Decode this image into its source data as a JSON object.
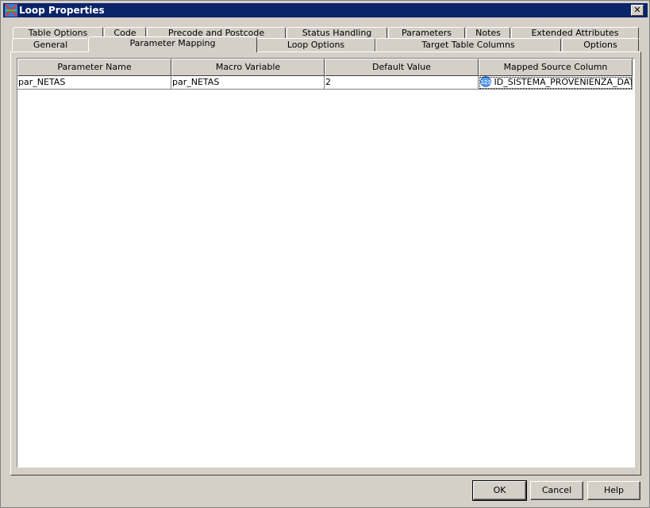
{
  "window": {
    "title": "Loop Properties",
    "close_label": "✕"
  },
  "tabs_row1": [
    "Table Options",
    "Code",
    "Precode and Postcode",
    "Status Handling",
    "Parameters",
    "Notes",
    "Extended Attributes"
  ],
  "tabs_row2": [
    "General",
    "Parameter Mapping",
    "Loop Options",
    "Target Table Columns",
    "Options"
  ],
  "active_tab": "Parameter Mapping",
  "table": {
    "columns": [
      "Parameter Name",
      "Macro Variable",
      "Default Value",
      "Mapped Source Column"
    ],
    "rows": [
      {
        "parameter_name": "par_NETAS",
        "macro_variable": "par_NETAS",
        "default_value": "2",
        "mapped_source_column": "ID_SISTEMA_PROVENIENZA_DATI",
        "mapped_icon": "numeric-column-icon"
      }
    ]
  },
  "buttons": {
    "ok": "OK",
    "cancel": "Cancel",
    "help": "Help"
  }
}
